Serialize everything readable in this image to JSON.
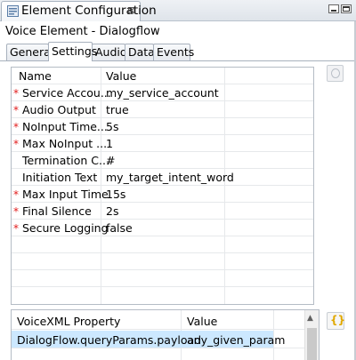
{
  "view": {
    "title": "Element Configuration",
    "close_glyph": "⊠",
    "icons": {
      "tab_icon": "element-config-icon",
      "minimize": "minimize-icon",
      "maximize": "maximize-icon"
    }
  },
  "element_title": "Voice Element - Dialogflow",
  "tabs": [
    {
      "label": "General",
      "active": false
    },
    {
      "label": "Settings",
      "active": true
    },
    {
      "label": "Audio",
      "active": false
    },
    {
      "label": "Data",
      "active": false
    },
    {
      "label": "Events",
      "active": false
    }
  ],
  "settings_table": {
    "columns": [
      "Name",
      "Value"
    ],
    "rows": [
      {
        "name": "Service Accou...",
        "value": "my_service_account",
        "required": true
      },
      {
        "name": "Audio Output",
        "value": "true",
        "required": true
      },
      {
        "name": "NoInput Time...",
        "value": "5s",
        "required": true
      },
      {
        "name": "Max NoInput ...",
        "value": "1",
        "required": true
      },
      {
        "name": "Termination C...",
        "value": "#",
        "required": false
      },
      {
        "name": "Initiation Text",
        "value": "my_target_intent_word",
        "required": false
      },
      {
        "name": "Max Input Time",
        "value": "15s",
        "required": true
      },
      {
        "name": "Final Silence",
        "value": "2s",
        "required": true
      },
      {
        "name": "Secure Logging",
        "value": "false",
        "required": true
      }
    ],
    "required_marker": "*"
  },
  "vxml_table": {
    "columns": [
      "VoiceXML Property",
      "Value"
    ],
    "rows": [
      {
        "property": "DialogFlow.queryParams.payload",
        "value": "any_given_param",
        "selected": true
      }
    ]
  },
  "buttons": {
    "side_button_icon": "info-icon",
    "json_button_glyph": "{}",
    "json_button_icon": "json-braces-icon"
  },
  "colors": {
    "required": "#e11b1b",
    "selection": "#cce8ff",
    "accent": "#e0a800"
  }
}
